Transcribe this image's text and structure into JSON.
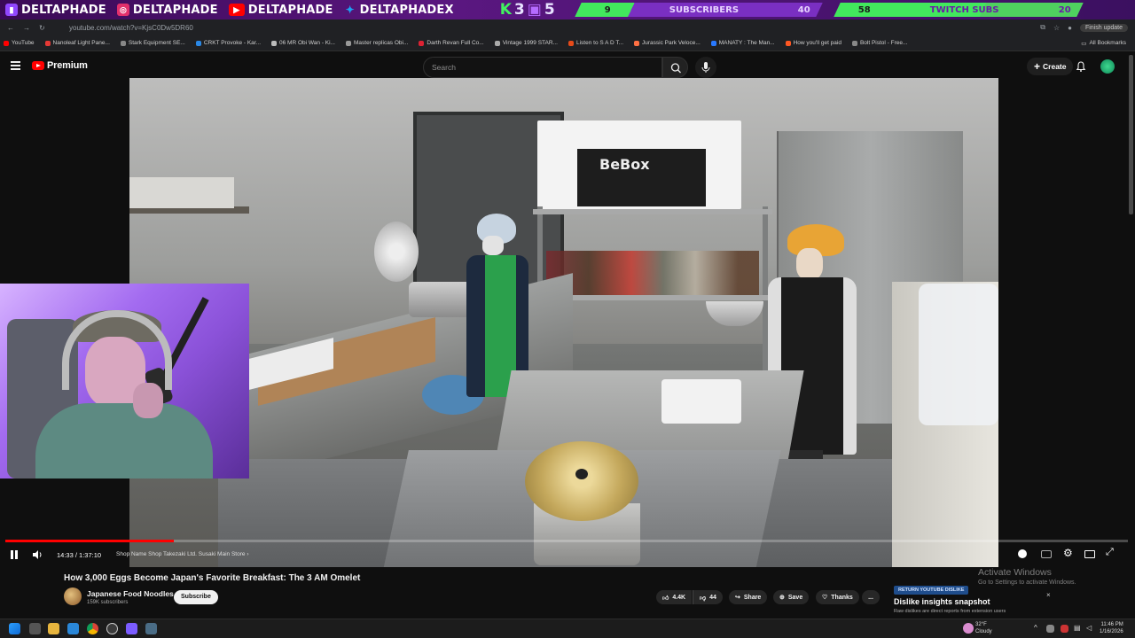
{
  "overlay": {
    "socials": [
      {
        "icon": "twitch-icon",
        "handle": "DELTAPHADE",
        "color": "#9146ff"
      },
      {
        "icon": "instagram-icon",
        "handle": "DELTAPHADE",
        "color": "#e1306c"
      },
      {
        "icon": "youtube-icon",
        "handle": "DELTAPHADE",
        "color": "#ff0000"
      },
      {
        "icon": "twitter-icon",
        "handle": "DELTAPHADEX",
        "color": "#1da1f2"
      }
    ],
    "k35": {
      "k": "K",
      "three": "3",
      "five": "5"
    },
    "goal1": {
      "current": "9",
      "label": "SUBSCRIBERS",
      "target": "40"
    },
    "goal2": {
      "current": "58",
      "label": "TWITCH SUBS",
      "target": "20"
    }
  },
  "browser": {
    "url": "youtube.com/watch?v=KjsC0Dw5DR60",
    "update_label": "Finish update",
    "bookmarks": [
      "YouTube",
      "Nanoleaf Light Pane...",
      "Stark Equipment SE...",
      "CRKT Provoke - Kar...",
      "06 MR Obi Wan - Ki...",
      "Master replicas Obi...",
      "Darth Revan Full Co...",
      "Vintage 1999 STAR...",
      "Listen to S A D T...",
      "Jurassic Park Veloce...",
      "MANATY : The Man...",
      "How you'll get paid",
      "Bolt Pistol - Free..."
    ],
    "all_bookmarks": "All Bookmarks"
  },
  "youtube": {
    "logo_text": "Premium",
    "search_placeholder": "Search",
    "create_label": "Create"
  },
  "player": {
    "time_current": "14:33",
    "time_total": "1:37:10",
    "time_display": "14:33 / 1:37:10",
    "chapter": "Shop Name Shop Takezaki Ltd. Susaki Main Store",
    "progress": 0.15
  },
  "video_info": {
    "title": "How 3,000 Eggs Become Japan's Favorite Breakfast: The 3 AM Omelet",
    "channel": "Japanese Food Noodles",
    "subscribers": "159K subscribers",
    "subscribe_label": "Subscribe",
    "likes": "4.4K",
    "dislikes": "44",
    "share_label": "Share",
    "save_label": "Save",
    "thanks_label": "Thanks",
    "more_label": "..."
  },
  "extension": {
    "button": "RETURN YOUTUBE DISLIKE",
    "title": "Dislike insights snapshot",
    "subtitle": "Raw dislikes are direct reports from extension users",
    "close": "×"
  },
  "watermark": {
    "line1": "Activate Windows",
    "line2": "Go to Settings to activate Windows."
  },
  "taskbar": {
    "weather_temp": "32°F",
    "weather_desc": "Cloudy",
    "time": "11:46 PM",
    "date": "1/16/2026"
  },
  "video_scene": {
    "box_text": "BeBox"
  }
}
